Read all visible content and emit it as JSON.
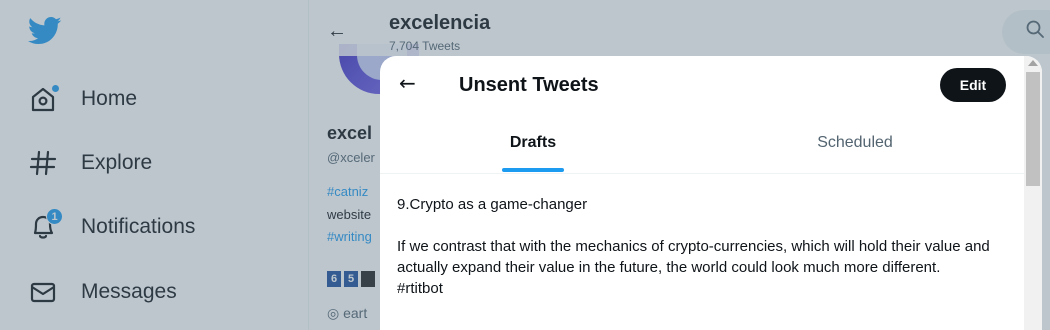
{
  "sidebar": {
    "logo": "twitter-bird-icon",
    "items": [
      {
        "label": "Home",
        "icon": "home-icon"
      },
      {
        "label": "Explore",
        "icon": "hashtag-icon"
      },
      {
        "label": "Notifications",
        "icon": "bell-icon",
        "badge": "1"
      },
      {
        "label": "Messages",
        "icon": "envelope-icon"
      }
    ]
  },
  "profile": {
    "title": "excelencia",
    "tweet_count": "7,704 Tweets",
    "name_partial": "excel",
    "handle_partial": "@xceler",
    "bio_line1": "#catniz",
    "bio_line2": "website",
    "bio_line3": "#writing",
    "badges": [
      "6",
      "5",
      ""
    ],
    "location_partial": "eart"
  },
  "modal": {
    "title": "Unsent Tweets",
    "edit_label": "Edit",
    "tabs": [
      {
        "label": "Drafts",
        "active": true
      },
      {
        "label": "Scheduled",
        "active": false
      }
    ],
    "draft": {
      "heading": "9.Crypto as a game-changer",
      "paragraph": "If we contrast that with the mechanics of crypto-currencies, which will hold their value and actually expand their value in the future, the world could look much more different.",
      "hashtag": "#rtitbot"
    }
  },
  "colors": {
    "accent": "#1d9bf0",
    "text": "#0f1419",
    "secondary_text": "#536471",
    "overlay": "rgba(91,112,131,0.4)"
  }
}
